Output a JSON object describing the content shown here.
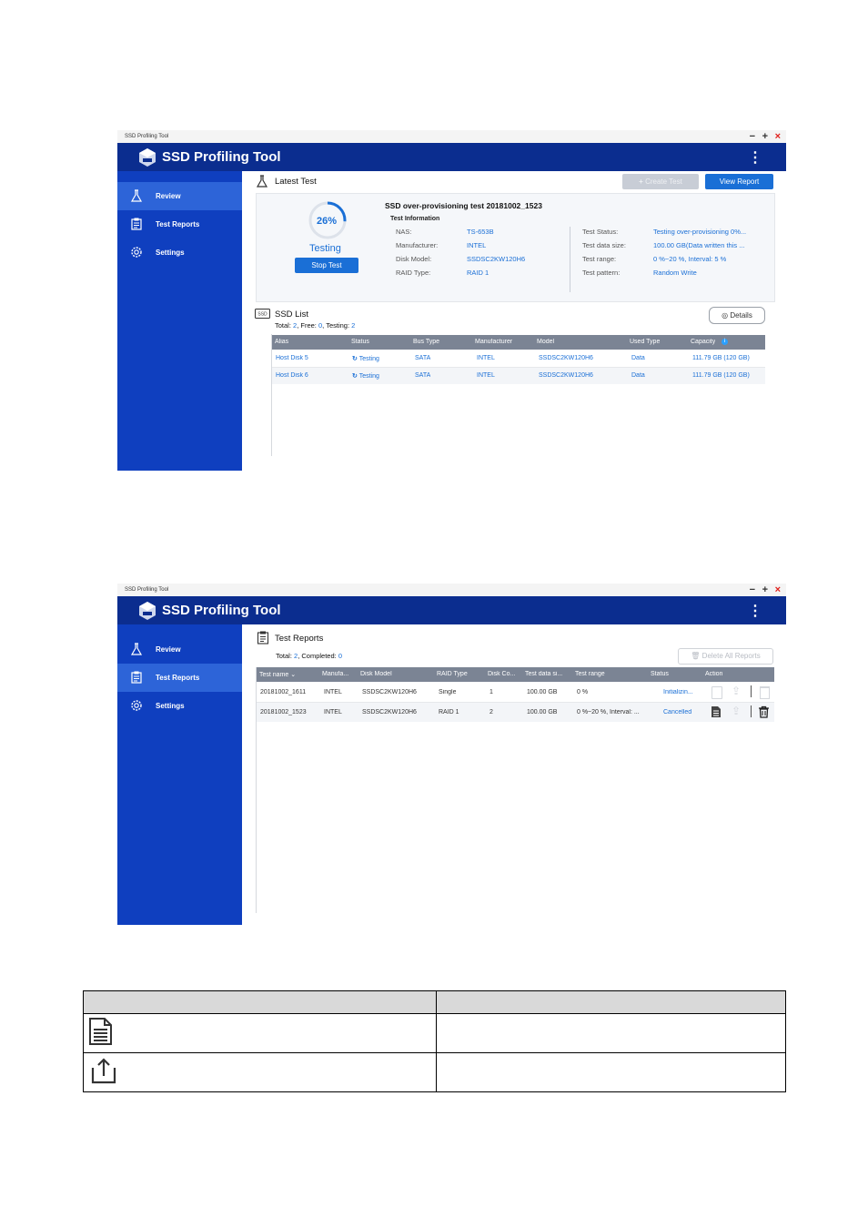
{
  "app": {
    "window_title": "SSD Profiling Tool",
    "header_title": "SSD Profiling Tool",
    "window_controls": [
      "−",
      "+",
      "×"
    ],
    "menu_icon": "more-vert-icon",
    "colors": {
      "header": "#0b2d8f",
      "sidebar": "#0f3fbf",
      "sidebar_active": "#2d64d8",
      "accent": "#1a6fd6"
    }
  },
  "sidebar": {
    "items": [
      {
        "label": "Review",
        "icon": "flask-icon"
      },
      {
        "label": "Test Reports",
        "icon": "clipboard-icon"
      },
      {
        "label": "Settings",
        "icon": "gear-icon"
      }
    ]
  },
  "screen1": {
    "active_nav": "Review",
    "latest_test": {
      "title": "Latest Test",
      "create_test_label": "Create Test",
      "view_report_label": "View Report",
      "progress_percent": 26,
      "progress_label": "26%",
      "status_label": "Testing",
      "stop_test_label": "Stop Test",
      "test_name": "SSD over-provisioning test 20181002_1523",
      "test_info_heading": "Test Information",
      "left_info": [
        {
          "key": "NAS:",
          "value": "TS-653B"
        },
        {
          "key": "Manufacturer:",
          "value": "INTEL"
        },
        {
          "key": "Disk Model:",
          "value": "SSDSC2KW120H6"
        },
        {
          "key": "RAID Type:",
          "value": "RAID 1"
        }
      ],
      "right_info": [
        {
          "key": "Test Status:",
          "value": "Testing over-provisioning 0%..."
        },
        {
          "key": "Test data size:",
          "value": "100.00 GB(Data written this ..."
        },
        {
          "key": "Test range:",
          "value": "0 %~20 %, Interval: 5 %"
        },
        {
          "key": "Test pattern:",
          "value": "Random Write"
        }
      ]
    },
    "ssd_list": {
      "title": "SSD List",
      "summary": {
        "total_label": "Total:",
        "total": "2",
        "free_label": ", Free:",
        "free": "0",
        "testing_label": ", Testing:",
        "testing": "2"
      },
      "details_label": "Details",
      "columns": [
        "Alias",
        "Status",
        "Bus Type",
        "Manufacturer",
        "Model",
        "Used Type",
        "Capacity"
      ],
      "rows": [
        [
          "Host Disk 5",
          "Testing",
          "SATA",
          "INTEL",
          "SSDSC2KW120H6",
          "Data",
          "111.79 GB (120 GB)"
        ],
        [
          "Host Disk 6",
          "Testing",
          "SATA",
          "INTEL",
          "SSDSC2KW120H6",
          "Data",
          "111.79 GB (120 GB)"
        ]
      ]
    }
  },
  "screen2": {
    "active_nav": "Test Reports",
    "title": "Test Reports",
    "summary": {
      "total_label": "Total:",
      "total": "2",
      "completed_label": ", Completed:",
      "completed": "0"
    },
    "delete_all_label": "Delete All Reports",
    "columns": [
      "Test name",
      "Manufa...",
      "Disk Model",
      "RAID Type",
      "Disk Co...",
      "Test data si...",
      "Test range",
      "Status",
      "Action"
    ],
    "rows": [
      {
        "cells": [
          "20181002_1611",
          "INTEL",
          "SSDSC2KW120H6",
          "Single",
          "1",
          "100.00 GB",
          "0 %"
        ],
        "status": "Initializin...",
        "actions_enabled": false
      },
      {
        "cells": [
          "20181002_1523",
          "INTEL",
          "SSDSC2KW120H6",
          "RAID 1",
          "2",
          "100.00 GB",
          "0 %~20 %, Interval: ..."
        ],
        "status": "Cancelled",
        "actions_enabled": true
      }
    ]
  },
  "legend_table": {
    "rows": [
      {
        "icon": "document-icon"
      },
      {
        "icon": "export-icon"
      }
    ]
  }
}
